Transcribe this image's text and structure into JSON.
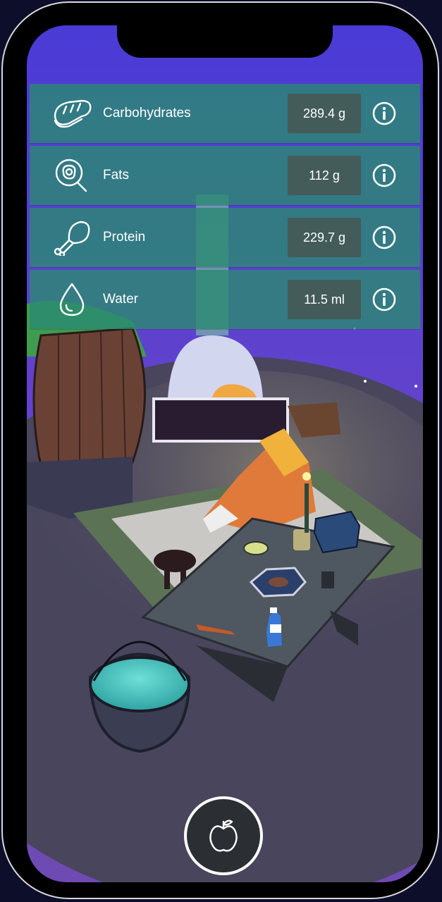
{
  "nutrients": [
    {
      "icon": "bread-icon",
      "label": "Carbohydrates",
      "value": "289.4 g"
    },
    {
      "icon": "fried-egg-icon",
      "label": "Fats",
      "value": "112 g"
    },
    {
      "icon": "drumstick-icon",
      "label": "Protein",
      "value": "229.7 g"
    },
    {
      "icon": "water-drop-icon",
      "label": "Water",
      "value": "11.5 ml"
    }
  ],
  "info_icon": "info-icon",
  "bottom_button": {
    "icon": "apple-icon"
  },
  "colors": {
    "panel": "#2a8a70",
    "value_box": "#465854",
    "sky": "#5b3ec4",
    "floor": "#4a4660"
  }
}
